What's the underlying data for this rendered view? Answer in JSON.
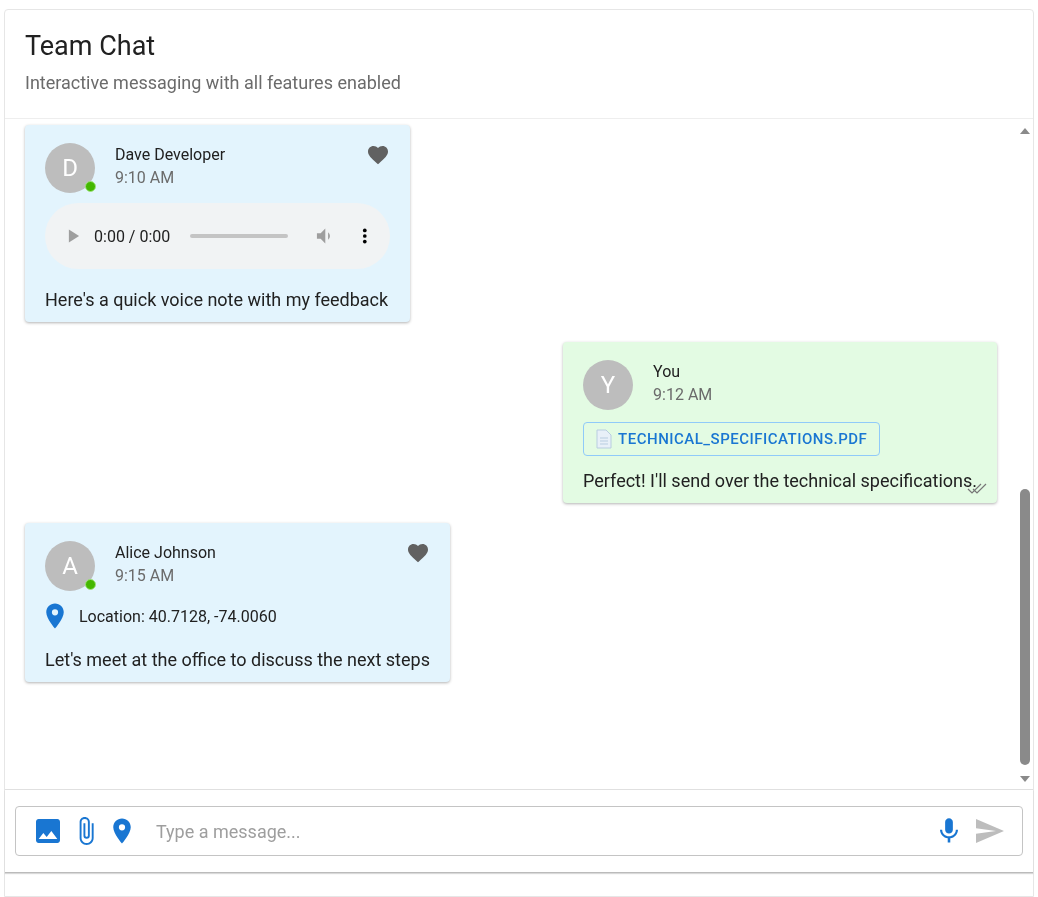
{
  "header": {
    "title": "Team Chat",
    "subtitle": "Interactive messaging with all features enabled"
  },
  "messages": [
    {
      "sender": "Dave Developer",
      "initial": "D",
      "time": "9:10 AM",
      "online": true,
      "outgoing": false,
      "liked": true,
      "read": false,
      "attachment": {
        "kind": "audio",
        "time": "0:00 / 0:00"
      },
      "text": "Here's a quick voice note with my feedback"
    },
    {
      "sender": "You",
      "initial": "Y",
      "time": "9:12 AM",
      "online": false,
      "outgoing": true,
      "liked": false,
      "read": true,
      "attachment": {
        "kind": "file",
        "label": "TECHNICAL_SPECIFICATIONS.PDF"
      },
      "text": "Perfect! I'll send over the technical specifications."
    },
    {
      "sender": "Alice Johnson",
      "initial": "A",
      "time": "9:15 AM",
      "online": true,
      "outgoing": false,
      "liked": true,
      "read": false,
      "attachment": {
        "kind": "location",
        "label": "Location: 40.7128, -74.0060"
      },
      "text": "Let's meet at the office to discuss the next steps"
    }
  ],
  "composer": {
    "placeholder": "Type a message...",
    "send_disabled": true
  }
}
